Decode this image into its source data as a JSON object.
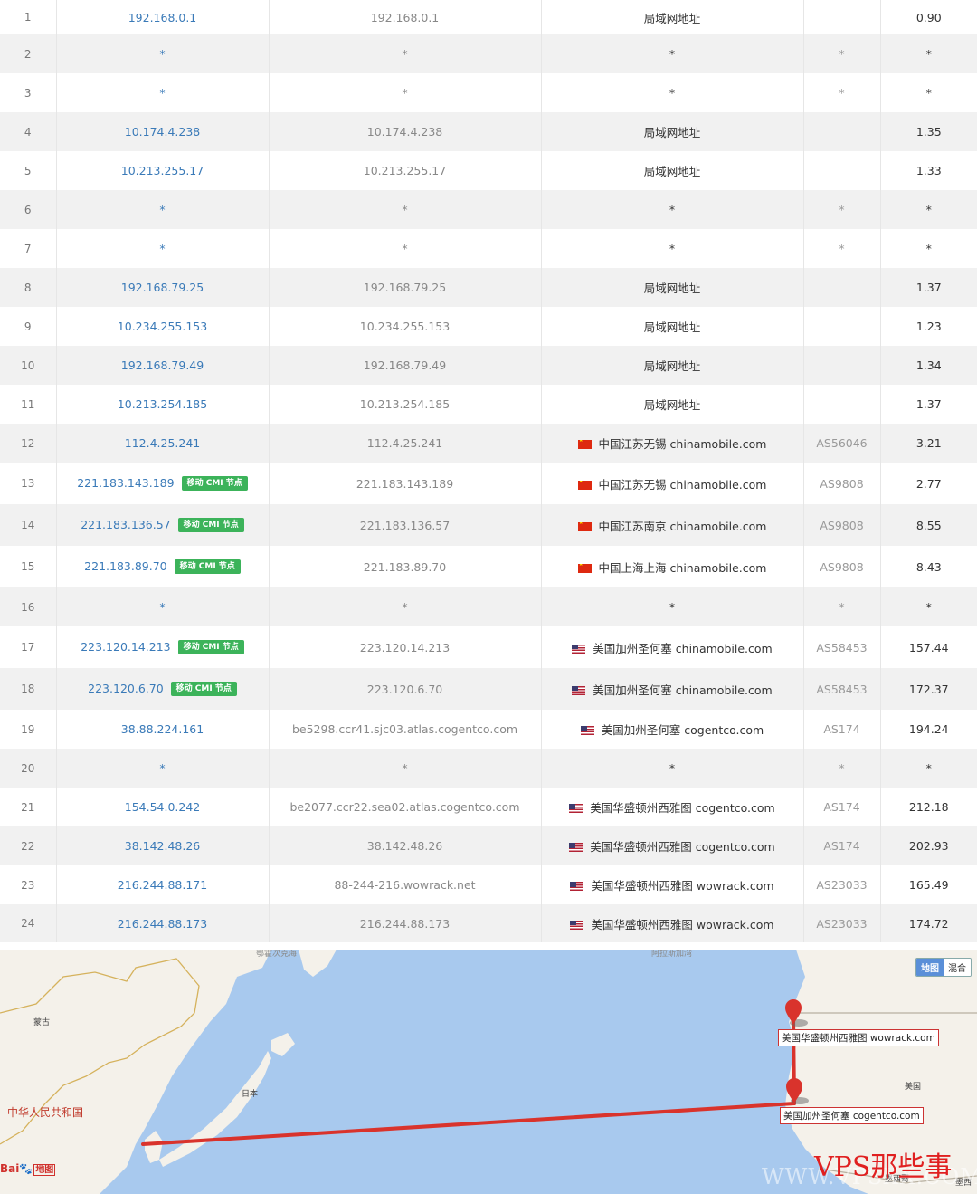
{
  "rows": [
    {
      "hop": "1",
      "ip": "192.168.0.1",
      "badge": "",
      "host": "192.168.0.1",
      "flag": "",
      "location": "局域网地址",
      "asn": "",
      "rtt": "0.90"
    },
    {
      "hop": "2",
      "ip": "*",
      "badge": "",
      "host": "*",
      "flag": "",
      "location": "*",
      "asn": "*",
      "rtt": "*"
    },
    {
      "hop": "3",
      "ip": "*",
      "badge": "",
      "host": "*",
      "flag": "",
      "location": "*",
      "asn": "*",
      "rtt": "*"
    },
    {
      "hop": "4",
      "ip": "10.174.4.238",
      "badge": "",
      "host": "10.174.4.238",
      "flag": "",
      "location": "局域网地址",
      "asn": "",
      "rtt": "1.35"
    },
    {
      "hop": "5",
      "ip": "10.213.255.17",
      "badge": "",
      "host": "10.213.255.17",
      "flag": "",
      "location": "局域网地址",
      "asn": "",
      "rtt": "1.33"
    },
    {
      "hop": "6",
      "ip": "*",
      "badge": "",
      "host": "*",
      "flag": "",
      "location": "*",
      "asn": "*",
      "rtt": "*"
    },
    {
      "hop": "7",
      "ip": "*",
      "badge": "",
      "host": "*",
      "flag": "",
      "location": "*",
      "asn": "*",
      "rtt": "*"
    },
    {
      "hop": "8",
      "ip": "192.168.79.25",
      "badge": "",
      "host": "192.168.79.25",
      "flag": "",
      "location": "局域网地址",
      "asn": "",
      "rtt": "1.37"
    },
    {
      "hop": "9",
      "ip": "10.234.255.153",
      "badge": "",
      "host": "10.234.255.153",
      "flag": "",
      "location": "局域网地址",
      "asn": "",
      "rtt": "1.23"
    },
    {
      "hop": "10",
      "ip": "192.168.79.49",
      "badge": "",
      "host": "192.168.79.49",
      "flag": "",
      "location": "局域网地址",
      "asn": "",
      "rtt": "1.34"
    },
    {
      "hop": "11",
      "ip": "10.213.254.185",
      "badge": "",
      "host": "10.213.254.185",
      "flag": "",
      "location": "局域网地址",
      "asn": "",
      "rtt": "1.37"
    },
    {
      "hop": "12",
      "ip": "112.4.25.241",
      "badge": "",
      "host": "112.4.25.241",
      "flag": "cn",
      "location": "中国江苏无锡 chinamobile.com",
      "asn": "AS56046",
      "rtt": "3.21"
    },
    {
      "hop": "13",
      "ip": "221.183.143.189",
      "badge": "移动 CMI 节点",
      "host": "221.183.143.189",
      "flag": "cn",
      "location": "中国江苏无锡 chinamobile.com",
      "asn": "AS9808",
      "rtt": "2.77"
    },
    {
      "hop": "14",
      "ip": "221.183.136.57",
      "badge": "移动 CMI 节点",
      "host": "221.183.136.57",
      "flag": "cn",
      "location": "中国江苏南京 chinamobile.com",
      "asn": "AS9808",
      "rtt": "8.55"
    },
    {
      "hop": "15",
      "ip": "221.183.89.70",
      "badge": "移动 CMI 节点",
      "host": "221.183.89.70",
      "flag": "cn",
      "location": "中国上海上海 chinamobile.com",
      "asn": "AS9808",
      "rtt": "8.43"
    },
    {
      "hop": "16",
      "ip": "*",
      "badge": "",
      "host": "*",
      "flag": "",
      "location": "*",
      "asn": "*",
      "rtt": "*"
    },
    {
      "hop": "17",
      "ip": "223.120.14.213",
      "badge": "移动 CMI 节点",
      "host": "223.120.14.213",
      "flag": "us",
      "location": "美国加州圣何塞 chinamobile.com",
      "asn": "AS58453",
      "rtt": "157.44"
    },
    {
      "hop": "18",
      "ip": "223.120.6.70",
      "badge": "移动 CMI 节点",
      "host": "223.120.6.70",
      "flag": "us",
      "location": "美国加州圣何塞 chinamobile.com",
      "asn": "AS58453",
      "rtt": "172.37"
    },
    {
      "hop": "19",
      "ip": "38.88.224.161",
      "badge": "",
      "host": "be5298.ccr41.sjc03.atlas.cogentco.com",
      "flag": "us",
      "location": "美国加州圣何塞 cogentco.com",
      "asn": "AS174",
      "rtt": "194.24"
    },
    {
      "hop": "20",
      "ip": "*",
      "badge": "",
      "host": "*",
      "flag": "",
      "location": "*",
      "asn": "*",
      "rtt": "*"
    },
    {
      "hop": "21",
      "ip": "154.54.0.242",
      "badge": "",
      "host": "be2077.ccr22.sea02.atlas.cogentco.com",
      "flag": "us",
      "location": "美国华盛顿州西雅图 cogentco.com",
      "asn": "AS174",
      "rtt": "212.18"
    },
    {
      "hop": "22",
      "ip": "38.142.48.26",
      "badge": "",
      "host": "38.142.48.26",
      "flag": "us",
      "location": "美国华盛顿州西雅图 cogentco.com",
      "asn": "AS174",
      "rtt": "202.93"
    },
    {
      "hop": "23",
      "ip": "216.244.88.171",
      "badge": "",
      "host": "88-244-216.wowrack.net",
      "flag": "us",
      "location": "美国华盛顿州西雅图 wowrack.com",
      "asn": "AS23033",
      "rtt": "165.49"
    },
    {
      "hop": "24",
      "ip": "216.244.88.173",
      "badge": "",
      "host": "216.244.88.173",
      "flag": "us",
      "location": "美国华盛顿州西雅图 wowrack.com",
      "asn": "AS23033",
      "rtt": "174.72"
    }
  ],
  "map": {
    "type_buttons": {
      "map": "地图",
      "hybrid": "混合"
    },
    "labels": {
      "mongolia": "蒙古",
      "china": "中华人民共和国",
      "japan": "日本",
      "usa": "美国",
      "okhotsk": "鄂霍次克海",
      "bering": "阿拉斯加湾",
      "mexico": "墨西哥",
      "mexico_east": "墨西"
    },
    "route_tags": {
      "seattle": "美国华盛顿州西雅图 wowrack.com",
      "sanjose": "美国加州圣何塞 cogentco.com"
    },
    "logo": {
      "bai": "Bai",
      "du": "地图"
    },
    "colors": {
      "route": "#d9332c",
      "sea": "#a8c9ee",
      "land": "#f4f1ea"
    }
  },
  "watermark": {
    "text": "VPS那些事",
    "url": "WWW.VPSXX.COM"
  }
}
